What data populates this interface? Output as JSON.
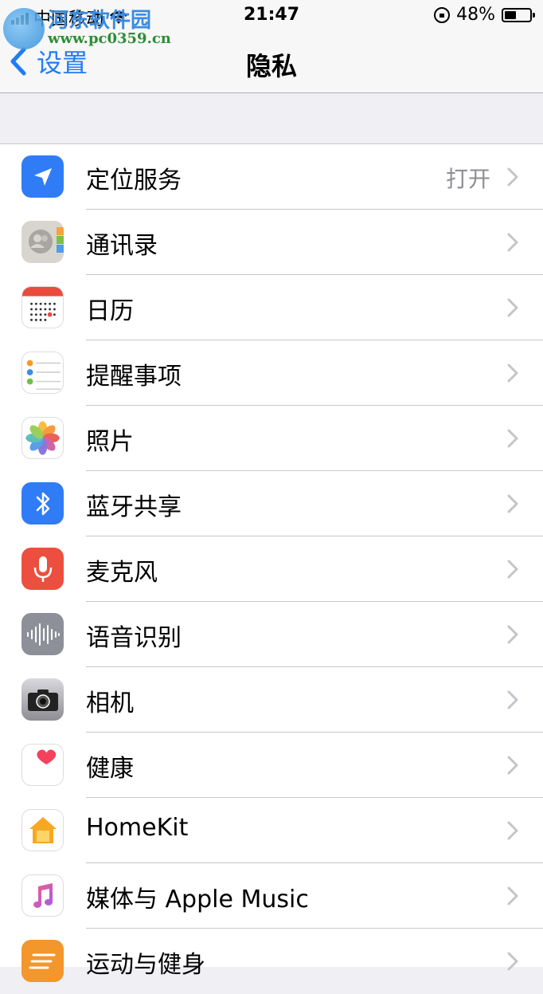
{
  "status_bar": {
    "carrier": "中国移动",
    "time": "21:47",
    "battery": "48%"
  },
  "watermark": {
    "name": "河东软件园",
    "url": "www.pc0359.cn"
  },
  "nav": {
    "back_label": "设置",
    "title": "隐私"
  },
  "rows": [
    {
      "label": "定位服务",
      "value": "打开",
      "icon": "location-icon"
    },
    {
      "label": "通讯录",
      "icon": "contacts-icon"
    },
    {
      "label": "日历",
      "icon": "calendar-icon"
    },
    {
      "label": "提醒事项",
      "icon": "reminders-icon"
    },
    {
      "label": "照片",
      "icon": "photos-icon"
    },
    {
      "label": "蓝牙共享",
      "icon": "bluetooth-icon"
    },
    {
      "label": "麦克风",
      "icon": "microphone-icon"
    },
    {
      "label": "语音识别",
      "icon": "speech-recognition-icon"
    },
    {
      "label": "相机",
      "icon": "camera-icon"
    },
    {
      "label": "健康",
      "icon": "health-icon"
    },
    {
      "label": "HomeKit",
      "icon": "homekit-icon"
    },
    {
      "label": "媒体与 Apple Music",
      "icon": "music-icon"
    },
    {
      "label": "运动与健身",
      "icon": "motion-fitness-icon"
    }
  ],
  "colors": {
    "accent": "#1f7cf5",
    "background": "#efeff4",
    "separator": "#c8c7cc"
  }
}
